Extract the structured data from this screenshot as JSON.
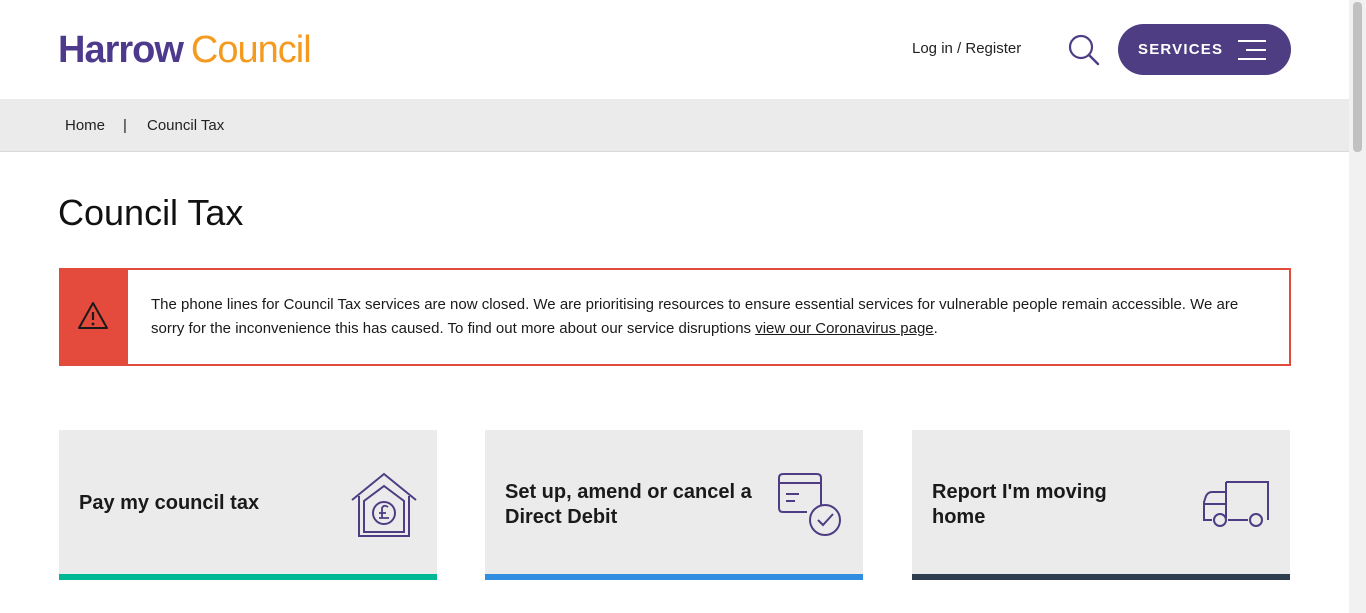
{
  "header": {
    "logo_primary": "Harrow",
    "logo_secondary": "Council",
    "login_label": "Log in / Register",
    "search_icon": "search-icon",
    "services_label": "SERVICES",
    "menu_icon": "hamburger-menu-icon"
  },
  "breadcrumb": {
    "home": "Home",
    "separator": "|",
    "current": "Council Tax"
  },
  "page_title": "Council Tax",
  "alert": {
    "icon": "warning-triangle-icon",
    "message": "The phone lines for Council Tax services are now closed. We are prioritising resources to ensure essential services for vulnerable people remain accessible. We are sorry for the inconvenience this has caused. To find out more about our service disruptions ",
    "link_text": "view our Coronavirus page",
    "suffix": ".",
    "accent_color": "#e54b3c"
  },
  "cards": [
    {
      "label": "Pay my council tax",
      "icon": "house-pound-icon",
      "bar_color": "#00b894"
    },
    {
      "label": "Set up, amend or cancel a Direct Debit",
      "icon": "card-check-icon",
      "bar_color": "#2f8ee0"
    },
    {
      "label": "Report I'm moving home",
      "icon": "removal-van-icon",
      "bar_color": "#2f3e4e"
    }
  ],
  "colors": {
    "brand_purple": "#4e3d83",
    "brand_orange": "#f39a1f"
  }
}
